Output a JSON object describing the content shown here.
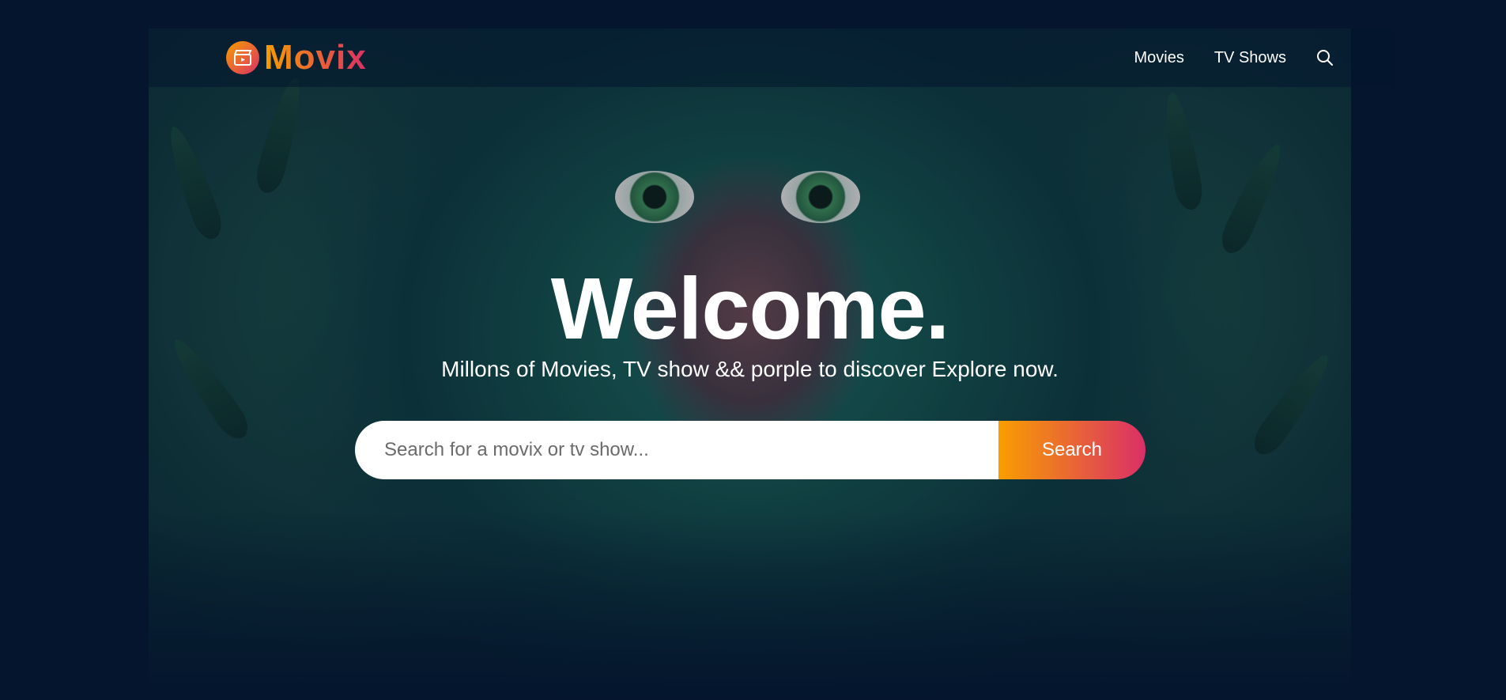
{
  "brand": {
    "name": "Movix",
    "accent_start": "#f89e00",
    "accent_end": "#da2f68"
  },
  "nav": {
    "items": [
      {
        "label": "Movies"
      },
      {
        "label": "TV Shows"
      }
    ],
    "search_icon": "search-icon"
  },
  "hero": {
    "title": "Welcome.",
    "subtitle": "Millons of Movies, TV show && porple to discover Explore now.",
    "search": {
      "placeholder": "Search for a movix or tv show...",
      "button_label": "Search"
    }
  },
  "colors": {
    "background": "#04152d"
  }
}
